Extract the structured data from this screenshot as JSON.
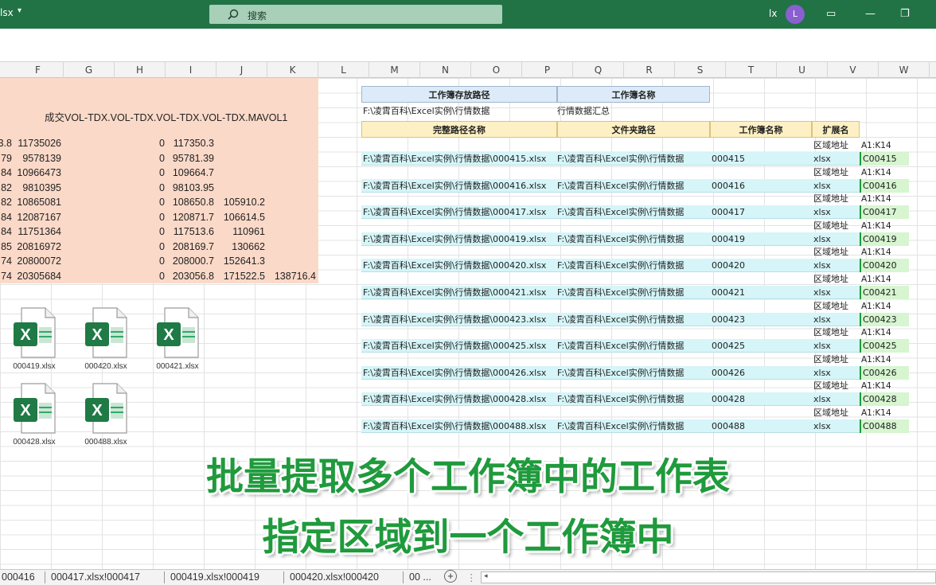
{
  "window": {
    "file_name": "lsx",
    "search_placeholder": "搜索",
    "user_initials": "lx",
    "avatar_letter": "L"
  },
  "columns": [
    "F",
    "G",
    "H",
    "I",
    "J",
    "K",
    "L",
    "M",
    "N",
    "O",
    "P",
    "Q",
    "R",
    "S",
    "T",
    "U",
    "V",
    "W"
  ],
  "left_block": {
    "header_text": "成交VOL-TDX.VOL-TDX.VOL-TDX.VOL-TDX.MAVOL1",
    "rows": [
      {
        "a": "3.8",
        "b": "11735026",
        "c": "0",
        "d": "117350.3",
        "e": "",
        "f": ""
      },
      {
        "a": "79",
        "b": "9578139",
        "c": "0",
        "d": "95781.39",
        "e": "",
        "f": ""
      },
      {
        "a": "84",
        "b": "10966473",
        "c": "0",
        "d": "109664.7",
        "e": "",
        "f": ""
      },
      {
        "a": "82",
        "b": "9810395",
        "c": "0",
        "d": "98103.95",
        "e": "",
        "f": ""
      },
      {
        "a": "82",
        "b": "10865081",
        "c": "0",
        "d": "108650.8",
        "e": "105910.2",
        "f": ""
      },
      {
        "a": "84",
        "b": "12087167",
        "c": "0",
        "d": "120871.7",
        "e": "106614.5",
        "f": ""
      },
      {
        "a": "84",
        "b": "11751364",
        "c": "0",
        "d": "117513.6",
        "e": "110961",
        "f": ""
      },
      {
        "a": "85",
        "b": "20816972",
        "c": "0",
        "d": "208169.7",
        "e": "130662",
        "f": ""
      },
      {
        "a": "74",
        "b": "20800072",
        "c": "0",
        "d": "208000.7",
        "e": "152641.3",
        "f": ""
      },
      {
        "a": "74",
        "b": "20305684",
        "c": "0",
        "d": "203056.8",
        "e": "171522.5",
        "f": "138716.4"
      }
    ]
  },
  "files": [
    {
      "name": "000419.xlsx",
      "letter": "X"
    },
    {
      "name": "000420.xlsx",
      "letter": "X"
    },
    {
      "name": "000421.xlsx",
      "letter": "X"
    },
    {
      "name": "000428.xlsx",
      "letter": "X"
    },
    {
      "name": "000488.xlsx",
      "letter": "X"
    }
  ],
  "right_table": {
    "header1": {
      "path_label": "工作簿存放路径",
      "name_label": "工作簿名称"
    },
    "header1_values": {
      "path": "F:\\凌霄百科\\Excel实例\\行情数据",
      "name": "行情数据汇总"
    },
    "header2": {
      "full_path": "完整路径名称",
      "folder": "文件夹路径",
      "book": "工作簿名称",
      "ext": "扩展名"
    },
    "region_label": "区域地址",
    "region_value": "A1:K14",
    "rows": [
      {
        "full": "F:\\凌霄百科\\Excel实例\\行情数据\\000415.xlsx",
        "folder": "F:\\凌霄百科\\Excel实例\\行情数据",
        "book": "000415",
        "ext": "xlsx",
        "code": "C00415"
      },
      {
        "full": "F:\\凌霄百科\\Excel实例\\行情数据\\000416.xlsx",
        "folder": "F:\\凌霄百科\\Excel实例\\行情数据",
        "book": "000416",
        "ext": "xlsx",
        "code": "C00416"
      },
      {
        "full": "F:\\凌霄百科\\Excel实例\\行情数据\\000417.xlsx",
        "folder": "F:\\凌霄百科\\Excel实例\\行情数据",
        "book": "000417",
        "ext": "xlsx",
        "code": "C00417"
      },
      {
        "full": "F:\\凌霄百科\\Excel实例\\行情数据\\000419.xlsx",
        "folder": "F:\\凌霄百科\\Excel实例\\行情数据",
        "book": "000419",
        "ext": "xlsx",
        "code": "C00419"
      },
      {
        "full": "F:\\凌霄百科\\Excel实例\\行情数据\\000420.xlsx",
        "folder": "F:\\凌霄百科\\Excel实例\\行情数据",
        "book": "000420",
        "ext": "xlsx",
        "code": "C00420"
      },
      {
        "full": "F:\\凌霄百科\\Excel实例\\行情数据\\000421.xlsx",
        "folder": "F:\\凌霄百科\\Excel实例\\行情数据",
        "book": "000421",
        "ext": "xlsx",
        "code": "C00421"
      },
      {
        "full": "F:\\凌霄百科\\Excel实例\\行情数据\\000423.xlsx",
        "folder": "F:\\凌霄百科\\Excel实例\\行情数据",
        "book": "000423",
        "ext": "xlsx",
        "code": "C00423"
      },
      {
        "full": "F:\\凌霄百科\\Excel实例\\行情数据\\000425.xlsx",
        "folder": "F:\\凌霄百科\\Excel实例\\行情数据",
        "book": "000425",
        "ext": "xlsx",
        "code": "C00425"
      },
      {
        "full": "F:\\凌霄百科\\Excel实例\\行情数据\\000426.xlsx",
        "folder": "F:\\凌霄百科\\Excel实例\\行情数据",
        "book": "000426",
        "ext": "xlsx",
        "code": "C00426"
      },
      {
        "full": "F:\\凌霄百科\\Excel实例\\行情数据\\000428.xlsx",
        "folder": "F:\\凌霄百科\\Excel实例\\行情数据",
        "book": "000428",
        "ext": "xlsx",
        "code": "C00428"
      },
      {
        "full": "F:\\凌霄百科\\Excel实例\\行情数据\\000488.xlsx",
        "folder": "F:\\凌霄百科\\Excel实例\\行情数据",
        "book": "000488",
        "ext": "xlsx",
        "code": "C00488"
      }
    ]
  },
  "caption": {
    "line1": "批量提取多个工作簿中的工作表",
    "line2": "指定区域到一个工作簿中",
    "color": "#1f9a3c"
  },
  "sheet_tabs": {
    "tabs": [
      "000416",
      "000417.xlsx!000417",
      "000419.xlsx!000419",
      "000420.xlsx!000420",
      "00 ..."
    ],
    "add_symbol": "+"
  },
  "colors": {
    "titlebar": "#217346",
    "salmon": "#fbd9c8",
    "cyan_row": "#d5f5f8",
    "green_cell": "#d6f5d0"
  }
}
